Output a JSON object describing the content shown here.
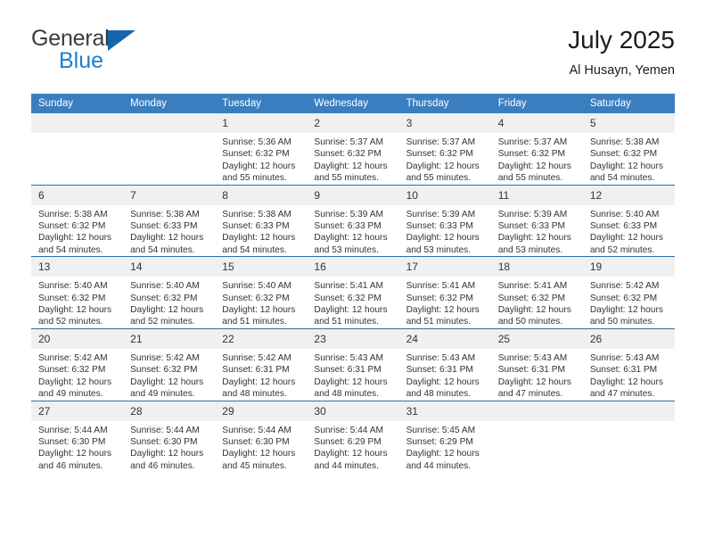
{
  "brand": {
    "word1": "General",
    "word2": "Blue",
    "triangle_color": "#1565ad",
    "word2_color": "#1a7fd4"
  },
  "header": {
    "title": "July 2025",
    "subtitle": "Al Husayn, Yemen"
  },
  "theme": {
    "header_row_bg": "#3b7ec0",
    "row_divider": "#2f6fa8",
    "daynum_bg": "#f0f0f0",
    "text": "#333333"
  },
  "weekdays": [
    "Sunday",
    "Monday",
    "Tuesday",
    "Wednesday",
    "Thursday",
    "Friday",
    "Saturday"
  ],
  "weeks": [
    [
      {
        "day": "",
        "sunrise": "",
        "sunset": "",
        "daylight1": "",
        "daylight2": ""
      },
      {
        "day": "",
        "sunrise": "",
        "sunset": "",
        "daylight1": "",
        "daylight2": ""
      },
      {
        "day": "1",
        "sunrise": "Sunrise: 5:36 AM",
        "sunset": "Sunset: 6:32 PM",
        "daylight1": "Daylight: 12 hours",
        "daylight2": "and 55 minutes."
      },
      {
        "day": "2",
        "sunrise": "Sunrise: 5:37 AM",
        "sunset": "Sunset: 6:32 PM",
        "daylight1": "Daylight: 12 hours",
        "daylight2": "and 55 minutes."
      },
      {
        "day": "3",
        "sunrise": "Sunrise: 5:37 AM",
        "sunset": "Sunset: 6:32 PM",
        "daylight1": "Daylight: 12 hours",
        "daylight2": "and 55 minutes."
      },
      {
        "day": "4",
        "sunrise": "Sunrise: 5:37 AM",
        "sunset": "Sunset: 6:32 PM",
        "daylight1": "Daylight: 12 hours",
        "daylight2": "and 55 minutes."
      },
      {
        "day": "5",
        "sunrise": "Sunrise: 5:38 AM",
        "sunset": "Sunset: 6:32 PM",
        "daylight1": "Daylight: 12 hours",
        "daylight2": "and 54 minutes."
      }
    ],
    [
      {
        "day": "6",
        "sunrise": "Sunrise: 5:38 AM",
        "sunset": "Sunset: 6:32 PM",
        "daylight1": "Daylight: 12 hours",
        "daylight2": "and 54 minutes."
      },
      {
        "day": "7",
        "sunrise": "Sunrise: 5:38 AM",
        "sunset": "Sunset: 6:33 PM",
        "daylight1": "Daylight: 12 hours",
        "daylight2": "and 54 minutes."
      },
      {
        "day": "8",
        "sunrise": "Sunrise: 5:38 AM",
        "sunset": "Sunset: 6:33 PM",
        "daylight1": "Daylight: 12 hours",
        "daylight2": "and 54 minutes."
      },
      {
        "day": "9",
        "sunrise": "Sunrise: 5:39 AM",
        "sunset": "Sunset: 6:33 PM",
        "daylight1": "Daylight: 12 hours",
        "daylight2": "and 53 minutes."
      },
      {
        "day": "10",
        "sunrise": "Sunrise: 5:39 AM",
        "sunset": "Sunset: 6:33 PM",
        "daylight1": "Daylight: 12 hours",
        "daylight2": "and 53 minutes."
      },
      {
        "day": "11",
        "sunrise": "Sunrise: 5:39 AM",
        "sunset": "Sunset: 6:33 PM",
        "daylight1": "Daylight: 12 hours",
        "daylight2": "and 53 minutes."
      },
      {
        "day": "12",
        "sunrise": "Sunrise: 5:40 AM",
        "sunset": "Sunset: 6:33 PM",
        "daylight1": "Daylight: 12 hours",
        "daylight2": "and 52 minutes."
      }
    ],
    [
      {
        "day": "13",
        "sunrise": "Sunrise: 5:40 AM",
        "sunset": "Sunset: 6:32 PM",
        "daylight1": "Daylight: 12 hours",
        "daylight2": "and 52 minutes."
      },
      {
        "day": "14",
        "sunrise": "Sunrise: 5:40 AM",
        "sunset": "Sunset: 6:32 PM",
        "daylight1": "Daylight: 12 hours",
        "daylight2": "and 52 minutes."
      },
      {
        "day": "15",
        "sunrise": "Sunrise: 5:40 AM",
        "sunset": "Sunset: 6:32 PM",
        "daylight1": "Daylight: 12 hours",
        "daylight2": "and 51 minutes."
      },
      {
        "day": "16",
        "sunrise": "Sunrise: 5:41 AM",
        "sunset": "Sunset: 6:32 PM",
        "daylight1": "Daylight: 12 hours",
        "daylight2": "and 51 minutes."
      },
      {
        "day": "17",
        "sunrise": "Sunrise: 5:41 AM",
        "sunset": "Sunset: 6:32 PM",
        "daylight1": "Daylight: 12 hours",
        "daylight2": "and 51 minutes."
      },
      {
        "day": "18",
        "sunrise": "Sunrise: 5:41 AM",
        "sunset": "Sunset: 6:32 PM",
        "daylight1": "Daylight: 12 hours",
        "daylight2": "and 50 minutes."
      },
      {
        "day": "19",
        "sunrise": "Sunrise: 5:42 AM",
        "sunset": "Sunset: 6:32 PM",
        "daylight1": "Daylight: 12 hours",
        "daylight2": "and 50 minutes."
      }
    ],
    [
      {
        "day": "20",
        "sunrise": "Sunrise: 5:42 AM",
        "sunset": "Sunset: 6:32 PM",
        "daylight1": "Daylight: 12 hours",
        "daylight2": "and 49 minutes."
      },
      {
        "day": "21",
        "sunrise": "Sunrise: 5:42 AM",
        "sunset": "Sunset: 6:32 PM",
        "daylight1": "Daylight: 12 hours",
        "daylight2": "and 49 minutes."
      },
      {
        "day": "22",
        "sunrise": "Sunrise: 5:42 AM",
        "sunset": "Sunset: 6:31 PM",
        "daylight1": "Daylight: 12 hours",
        "daylight2": "and 48 minutes."
      },
      {
        "day": "23",
        "sunrise": "Sunrise: 5:43 AM",
        "sunset": "Sunset: 6:31 PM",
        "daylight1": "Daylight: 12 hours",
        "daylight2": "and 48 minutes."
      },
      {
        "day": "24",
        "sunrise": "Sunrise: 5:43 AM",
        "sunset": "Sunset: 6:31 PM",
        "daylight1": "Daylight: 12 hours",
        "daylight2": "and 48 minutes."
      },
      {
        "day": "25",
        "sunrise": "Sunrise: 5:43 AM",
        "sunset": "Sunset: 6:31 PM",
        "daylight1": "Daylight: 12 hours",
        "daylight2": "and 47 minutes."
      },
      {
        "day": "26",
        "sunrise": "Sunrise: 5:43 AM",
        "sunset": "Sunset: 6:31 PM",
        "daylight1": "Daylight: 12 hours",
        "daylight2": "and 47 minutes."
      }
    ],
    [
      {
        "day": "27",
        "sunrise": "Sunrise: 5:44 AM",
        "sunset": "Sunset: 6:30 PM",
        "daylight1": "Daylight: 12 hours",
        "daylight2": "and 46 minutes."
      },
      {
        "day": "28",
        "sunrise": "Sunrise: 5:44 AM",
        "sunset": "Sunset: 6:30 PM",
        "daylight1": "Daylight: 12 hours",
        "daylight2": "and 46 minutes."
      },
      {
        "day": "29",
        "sunrise": "Sunrise: 5:44 AM",
        "sunset": "Sunset: 6:30 PM",
        "daylight1": "Daylight: 12 hours",
        "daylight2": "and 45 minutes."
      },
      {
        "day": "30",
        "sunrise": "Sunrise: 5:44 AM",
        "sunset": "Sunset: 6:29 PM",
        "daylight1": "Daylight: 12 hours",
        "daylight2": "and 44 minutes."
      },
      {
        "day": "31",
        "sunrise": "Sunrise: 5:45 AM",
        "sunset": "Sunset: 6:29 PM",
        "daylight1": "Daylight: 12 hours",
        "daylight2": "and 44 minutes."
      },
      {
        "day": "",
        "sunrise": "",
        "sunset": "",
        "daylight1": "",
        "daylight2": ""
      },
      {
        "day": "",
        "sunrise": "",
        "sunset": "",
        "daylight1": "",
        "daylight2": ""
      }
    ]
  ]
}
